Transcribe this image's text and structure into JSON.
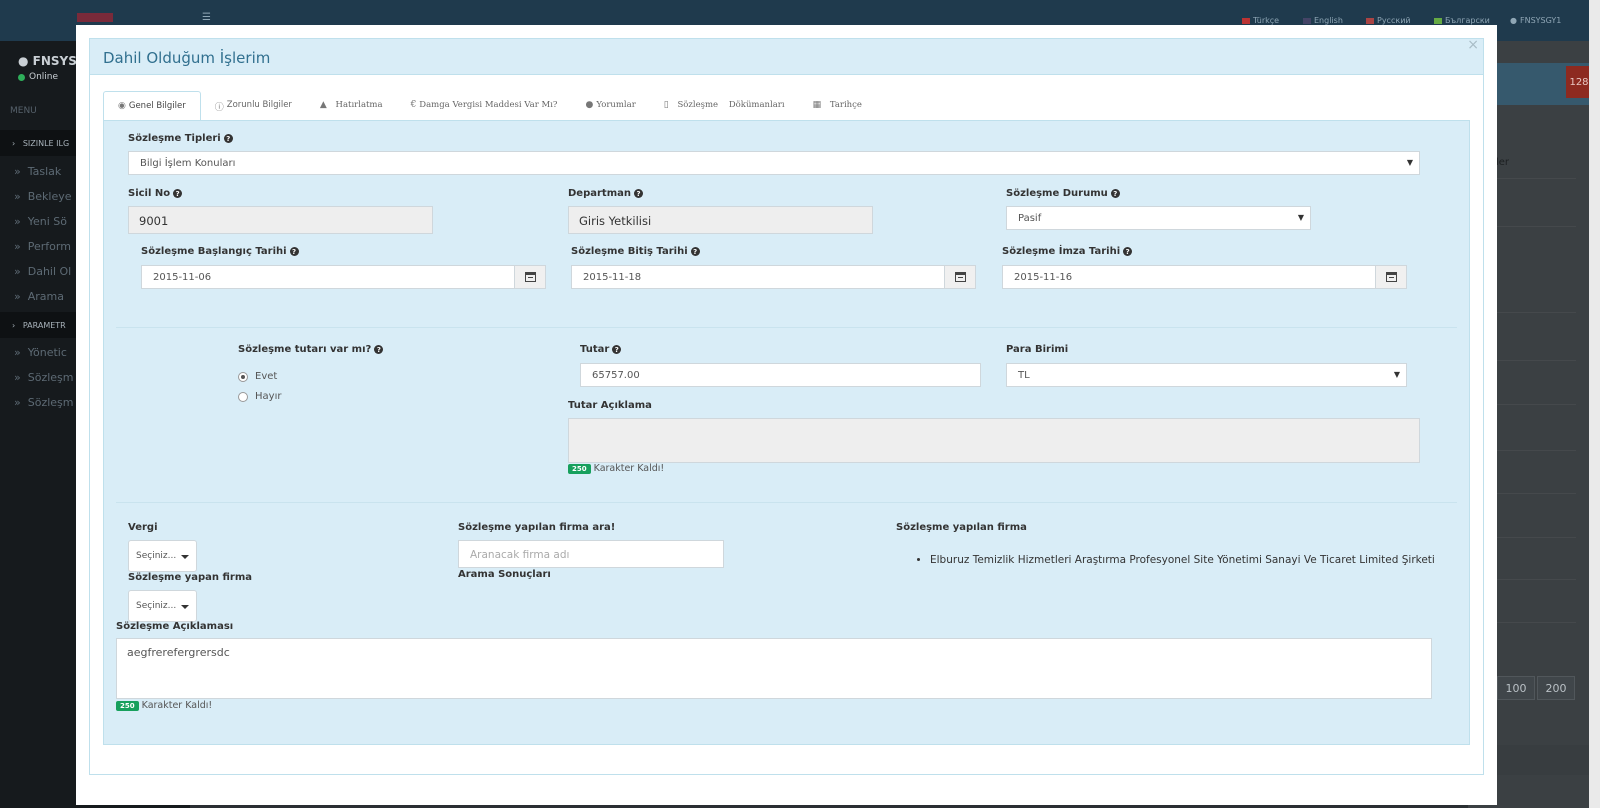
{
  "background": {
    "languages": [
      "Türkçe",
      "English",
      "Русский",
      "Български"
    ],
    "user_top": "FNSYSGY1",
    "sidebar_user": "FNSYSG",
    "status": "Online",
    "menu_label": "MENU",
    "section_1": "SIZINLE ILG",
    "section_2": "PARAMETR",
    "items": [
      "Taslak",
      "Bekleye",
      "Yeni Sö",
      "Perform",
      "Dahil Ol",
      "Arama",
      "Yönetic",
      "Sözleşm",
      "Sözleşm"
    ],
    "badge": "128",
    "right_text": "ler",
    "pages": [
      "100",
      "200"
    ]
  },
  "modal": {
    "title": "Dahil Olduğum İşlerim",
    "close": "×",
    "tabs": [
      {
        "label": "Genel Bilgiler",
        "icon": "globe-icon"
      },
      {
        "label": "Zorunlu Bilgiler",
        "icon": "info-icon"
      },
      {
        "label": "Hatırlatma",
        "icon": "bell-icon"
      },
      {
        "label": "Damga Vergisi Maddesi Var Mı?",
        "icon": "euro-icon"
      },
      {
        "label": "Yorumlar",
        "icon": "comment-icon"
      },
      {
        "label": "Sözleşme    Dökümanları",
        "icon": "file-icon"
      },
      {
        "label": "Tarihçe",
        "icon": "calendar-icon"
      }
    ]
  },
  "form": {
    "contract_types_label": "Sözleşme Tipleri",
    "contract_types_value": "Bilgi İşlem Konuları",
    "registry_label": "Sicil No",
    "registry_value": "9001",
    "department_label": "Departman",
    "department_value": "Giris Yetkilisi",
    "status_label": "Sözleşme Durumu",
    "status_value": "Pasif",
    "start_date_label": "Sözleşme Başlangıç Tarihi",
    "start_date_value": "2015-11-06",
    "end_date_label": "Sözleşme Bitiş Tarihi",
    "end_date_value": "2015-11-18",
    "sign_date_label": "Sözleşme İmza Tarihi",
    "sign_date_value": "2015-11-16",
    "has_amount_label": "Sözleşme tutarı var mı?",
    "radio_yes": "Evet",
    "radio_no": "Hayır",
    "amount_label": "Tutar",
    "amount_value": "65757.00",
    "currency_label": "Para Birimi",
    "currency_value": "TL",
    "amount_desc_label": "Tutar Açıklama",
    "counter_value": "250",
    "counter_text": "Karakter Kaldı!",
    "tax_label": "Vergi",
    "select_placeholder": "Seçiniz...",
    "contracting_firm_label": "Sözleşme yapan firma",
    "search_firm_label": "Sözleşme yapılan firma ara!",
    "search_firm_placeholder": "Aranacak firma adı",
    "search_results_label": "Arama Sonuçları",
    "contracted_firm_label": "Sözleşme yapılan firma",
    "contracted_firm_value": "Elburuz Temizlik Hizmetleri Araştırma Profesyonel Site Yönetimi Sanayi Ve Ticaret Limited Şirketi",
    "description_label": "Sözleşme Açıklaması",
    "description_value": "aegfrerefergrersdc"
  }
}
